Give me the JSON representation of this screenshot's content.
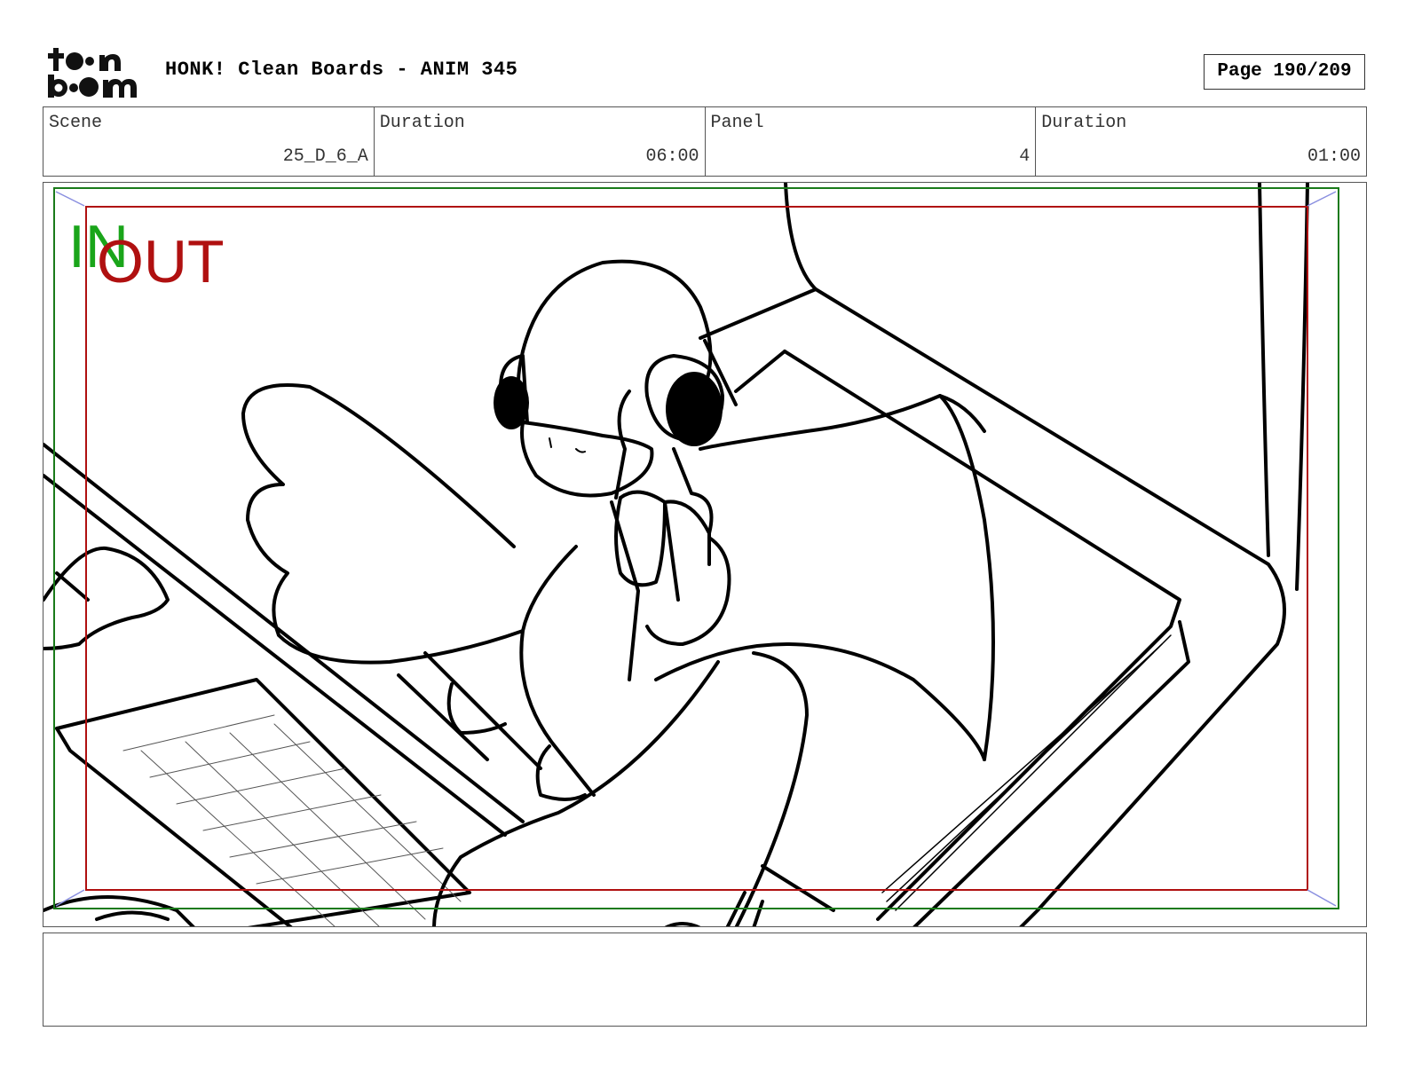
{
  "header": {
    "logo_text_top": "toon",
    "logo_text_bottom": "boom",
    "title": "HONK! Clean Boards - ANIM 345",
    "page": "Page 190/209"
  },
  "info": {
    "scene_label": "Scene",
    "scene_value": "25_D_6_A",
    "duration_label": "Duration",
    "duration_value": "06:00",
    "panel_label": "Panel",
    "panel_value": "4",
    "panel_duration_label": "Duration",
    "panel_duration_value": "01:00"
  },
  "frame": {
    "in_label": "IN",
    "out_label": "OUT",
    "in_color": "#1aa51a",
    "out_color": "#b01010"
  },
  "notes": {
    "text": ""
  }
}
